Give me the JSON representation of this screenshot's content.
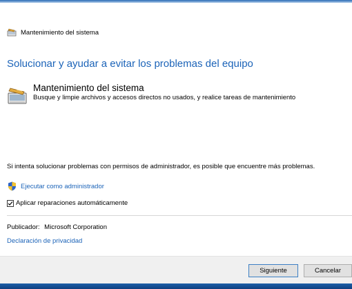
{
  "window": {
    "title": "Mantenimiento del sistema"
  },
  "main": {
    "heading": "Solucionar y ayudar a evitar los problemas del equipo",
    "tool": {
      "title": "Mantenimiento del sistema",
      "description": "Busque y limpie archivos y accesos directos no usados, y realice tareas de mantenimiento"
    },
    "admin_notice": "Si intenta solucionar problemas con permisos de administrador, es posible que encuentre más problemas.",
    "admin_link": "Ejecutar como administrador",
    "auto_repair": {
      "label": "Aplicar reparaciones automáticamente",
      "checked": true
    },
    "publisher": {
      "label": "Publicador:",
      "value": "Microsoft Corporation"
    },
    "privacy_link": "Declaración de privacidad"
  },
  "footer": {
    "next_label": "Siguiente",
    "cancel_label": "Cancelar"
  },
  "colors": {
    "link": "#1b63b8",
    "footer_bg": "#f0f0f0",
    "button_bg": "#e1e1e1"
  },
  "icons": {
    "app": "maintenance-icon",
    "shield": "uac-shield-icon"
  }
}
